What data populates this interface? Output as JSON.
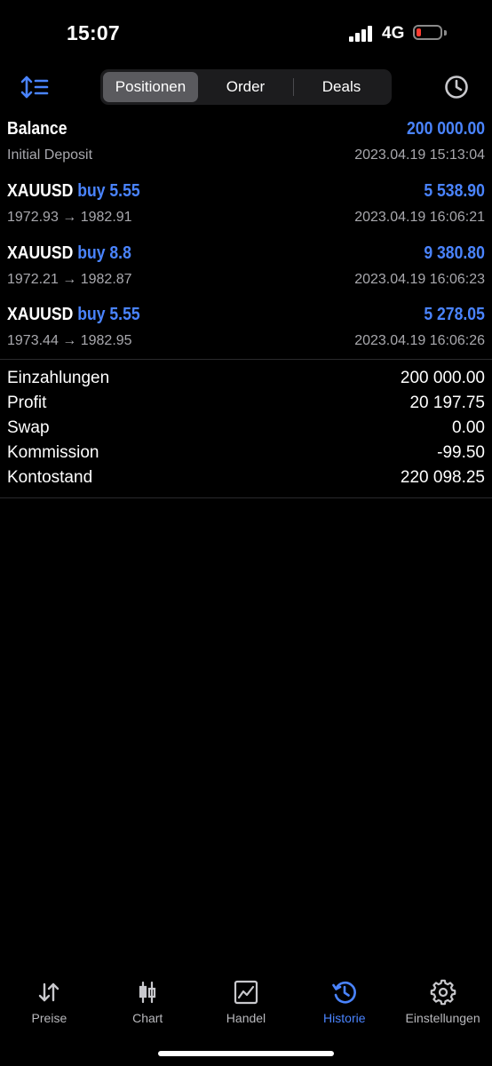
{
  "status_bar": {
    "time": "15:07",
    "network": "4G",
    "battery_level": 0.2,
    "battery_color": "#ff3b30"
  },
  "toolbar": {
    "sort_icon": "sort-icon",
    "tabs": [
      {
        "label": "Positionen",
        "active": true
      },
      {
        "label": "Order",
        "active": false
      },
      {
        "label": "Deals",
        "active": false
      }
    ],
    "clock_icon": "clock-icon"
  },
  "history": {
    "balance": {
      "title": "Balance",
      "value": "200 000.00",
      "subtitle": "Initial Deposit",
      "date": "2023.04.19 15:13:04"
    },
    "deals": [
      {
        "symbol": "XAUUSD",
        "side": "buy 5.55",
        "profit": "5 538.90",
        "prices": "1972.93 → 1982.91",
        "date": "2023.04.19 16:06:21"
      },
      {
        "symbol": "XAUUSD",
        "side": "buy 8.8",
        "profit": "9 380.80",
        "prices": "1972.21 → 1982.87",
        "date": "2023.04.19 16:06:23"
      },
      {
        "symbol": "XAUUSD",
        "side": "buy 5.55",
        "profit": "5 278.05",
        "prices": "1973.44 → 1982.95",
        "date": "2023.04.19 16:06:26"
      }
    ]
  },
  "summary": [
    {
      "label": "Einzahlungen",
      "value": "200 000.00"
    },
    {
      "label": "Profit",
      "value": "20 197.75"
    },
    {
      "label": "Swap",
      "value": "0.00"
    },
    {
      "label": "Kommission",
      "value": "-99.50"
    },
    {
      "label": "Kontostand",
      "value": "220 098.25"
    }
  ],
  "tab_bar": [
    {
      "label": "Preise",
      "icon": "arrows-updown-icon",
      "active": false
    },
    {
      "label": "Chart",
      "icon": "candlestick-icon",
      "active": false
    },
    {
      "label": "Handel",
      "icon": "trade-chart-icon",
      "active": false
    },
    {
      "label": "Historie",
      "icon": "history-icon",
      "active": true
    },
    {
      "label": "Einstellungen",
      "icon": "gear-icon",
      "active": false
    }
  ],
  "colors": {
    "accent": "#4a84ff",
    "background": "#000000",
    "secondary_text": "#a8a8ad"
  }
}
